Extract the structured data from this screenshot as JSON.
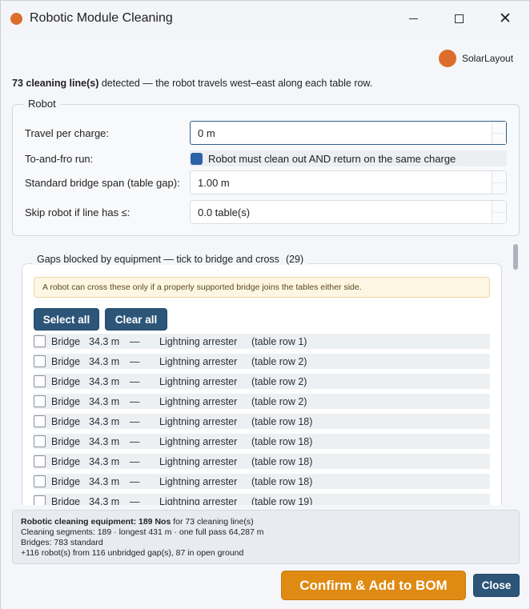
{
  "window": {
    "title": "Robotic Module Cleaning"
  },
  "brand": {
    "name": "SolarLayout"
  },
  "summary": {
    "count_bold": "73 cleaning line(s)",
    "rest": " detected — the robot travels west–east along each table row."
  },
  "robot": {
    "legend": "Robot",
    "travel_label": "Travel per charge:",
    "travel_value": "0 m",
    "tofro_label": "To-and-fro run:",
    "tofro_checkbox_label": "Robot must clean out AND return on the same charge",
    "tofro_checked": true,
    "bridge_label": "Standard bridge span (table gap):",
    "bridge_value": "1.00 m",
    "skip_label": "Skip robot if line has ≤:",
    "skip_value": "0.0 table(s)"
  },
  "gaps": {
    "legend": "Gaps blocked by equipment — tick to bridge and cross",
    "count": "(29)",
    "notice": "A robot can cross these only if a properly supported bridge joins the tables either side.",
    "select_all_label": "Select all",
    "clear_all_label": "Clear all",
    "items": [
      {
        "word": "Bridge",
        "length": "34.3 m",
        "dash": "—",
        "equipment": "Lightning arrester",
        "row": "(table row 1)"
      },
      {
        "word": "Bridge",
        "length": "34.3 m",
        "dash": "—",
        "equipment": "Lightning arrester",
        "row": "(table row 2)"
      },
      {
        "word": "Bridge",
        "length": "34.3 m",
        "dash": "—",
        "equipment": "Lightning arrester",
        "row": "(table row 2)"
      },
      {
        "word": "Bridge",
        "length": "34.3 m",
        "dash": "—",
        "equipment": "Lightning arrester",
        "row": "(table row 2)"
      },
      {
        "word": "Bridge",
        "length": "34.3 m",
        "dash": "—",
        "equipment": "Lightning arrester",
        "row": "(table row 18)"
      },
      {
        "word": "Bridge",
        "length": "34.3 m",
        "dash": "—",
        "equipment": "Lightning arrester",
        "row": "(table row 18)"
      },
      {
        "word": "Bridge",
        "length": "34.3 m",
        "dash": "—",
        "equipment": "Lightning arrester",
        "row": "(table row 18)"
      },
      {
        "word": "Bridge",
        "length": "34.3 m",
        "dash": "—",
        "equipment": "Lightning arrester",
        "row": "(table row 18)"
      },
      {
        "word": "Bridge",
        "length": "34.3 m",
        "dash": "—",
        "equipment": "Lightning arrester",
        "row": "(table row 19)"
      }
    ]
  },
  "stats": {
    "line1_bold": "Robotic cleaning equipment: 189 Nos",
    "line1_rest": " for 73 cleaning line(s)",
    "line2": "Cleaning segments: 189  ·  longest 431 m  ·  one full pass 64,287 m",
    "line3": "Bridges: 783 standard",
    "line4": "+116 robot(s) from 116 unbridged gap(s), 87 in open ground"
  },
  "footer": {
    "confirm_label": "Confirm & Add to BOM",
    "close_label": "Close"
  },
  "colors": {
    "accent_orange": "#df8a13",
    "dark_button": "#2c5578",
    "brand_dot": "#dc6d2c",
    "checkbox_blue": "#2c62a6"
  }
}
